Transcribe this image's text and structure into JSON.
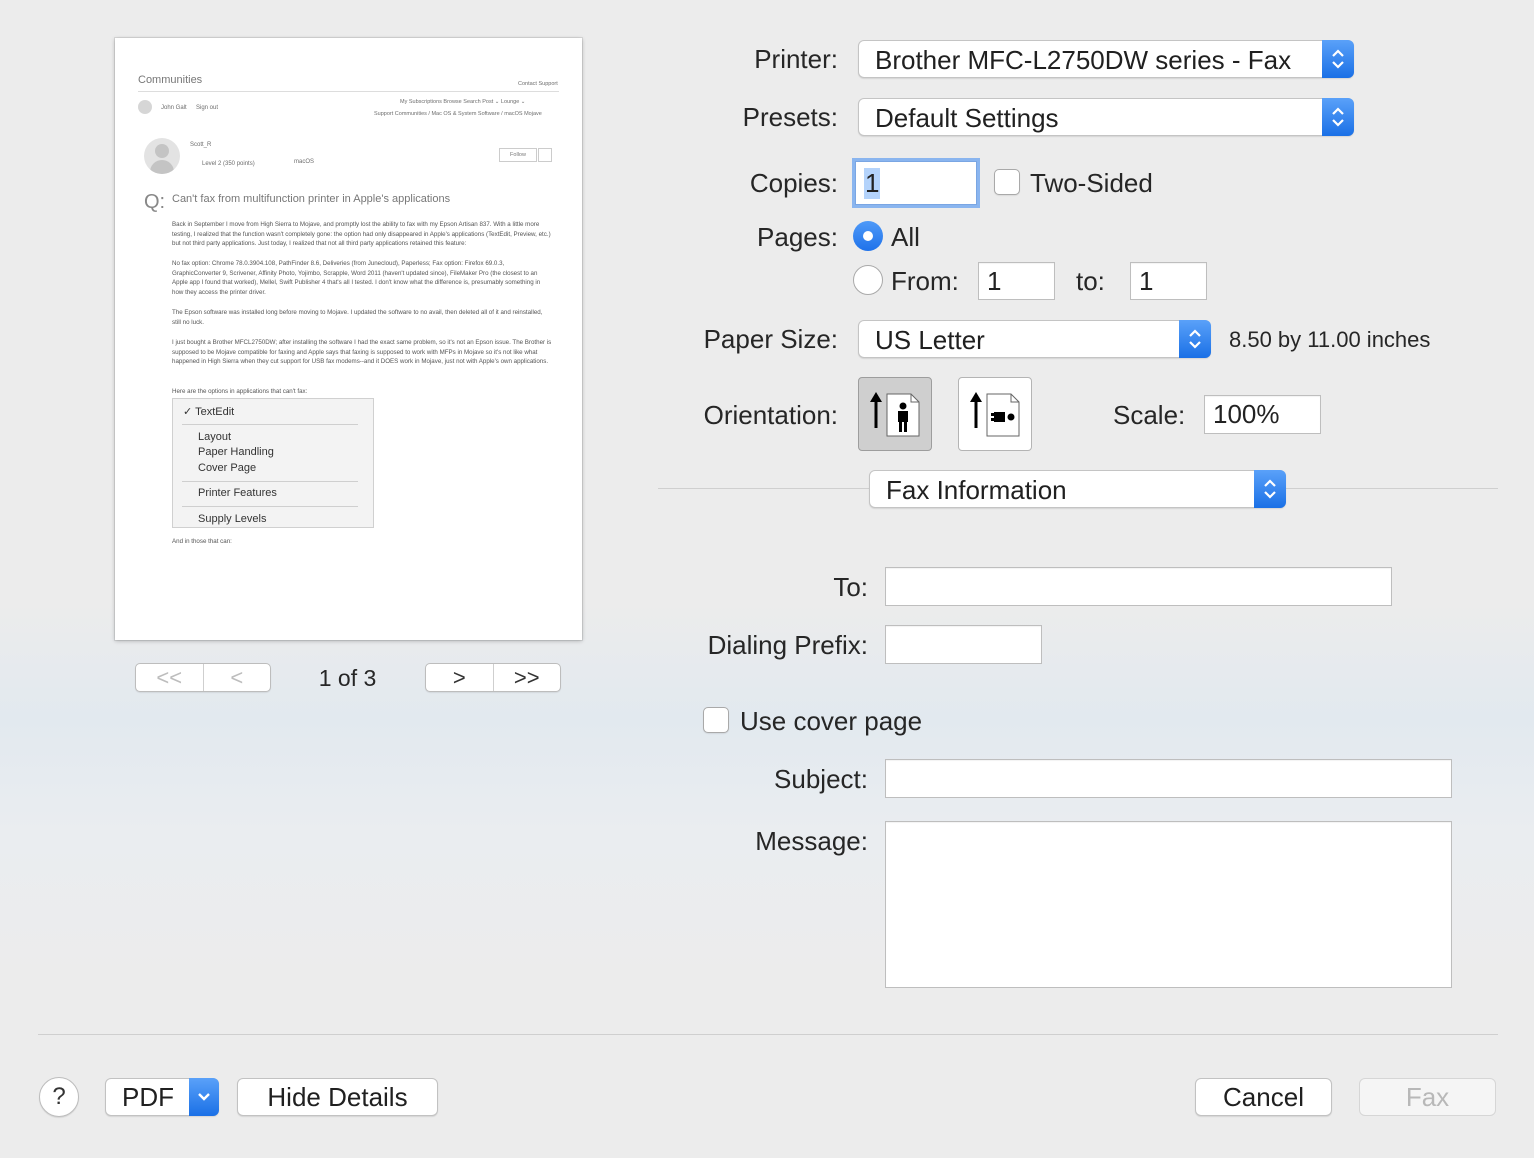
{
  "preview": {
    "header_title": "Communities",
    "contact_support": "Contact Support",
    "user_name": "John Galt",
    "sign_out": "Sign out",
    "nav_links": "My Subscriptions     Browse     Search     Post ⌄     Lounge ⌄",
    "breadcrumb": "Support Communities  /  Mac OS & System Software  /  macOS Mojave",
    "author": "Scott_R",
    "author_level": "Level 2  (350 points)",
    "product": "macOS",
    "follow": "Follow",
    "q_mark": "Q:",
    "question_title": "Can't fax from multifunction printer in Apple's applications",
    "para1": "Back in September I move from High Sierra to Mojave, and promptly lost the ability to fax with my Epson Artisan 837. With a little more testing, I realized that the function wasn't completely gone: the option had only disappeared in Apple's applications (TextEdit, Preview, etc.) but not third party applications. Just today, I realized that not all third party applications retained this feature:",
    "para1b": "No fax option: Chrome 78.0.3904.108, PathFinder 8.6, Deliveries (from Junecloud), Paperless; Fax option: Firefox 69.0.3, GraphicConverter 9, Scrivener, Affinity Photo, Yojimbo, Scrapple, Word 2011 (haven't updated since), FileMaker Pro (the closest to an Apple app I found that worked), Mellel, Swift Publisher 4 that's all I tested. I don't know what the difference is, presumably something in how they access the printer driver.",
    "para2": "The Epson software was installed long before moving to Mojave. I updated the software to no avail, then deleted all of it and reinstalled, still no luck.",
    "para3": "I just bought a Brother MFCL2750DW; after installing the software I had the exact same problem, so it's not an Epson issue. The Brother is supposed to be Mojave compatible for faxing and Apple says that faxing is supposed to work with MFPs in Mojave so it's not like what happened in High Sierra when they cut support for USB fax modems--and it DOES work in Mojave, just not with Apple's own applications.",
    "para4": "Here are the options in applications that can't fax:",
    "menu_items": [
      "✓  TextEdit",
      "Layout",
      "Paper Handling",
      "Cover Page",
      "Printer Features",
      "Supply Levels"
    ],
    "para5": "And in those that can:"
  },
  "page_nav": {
    "first": "<<",
    "prev": "<",
    "status": "1 of 3",
    "next": ">",
    "last": ">>"
  },
  "printer": {
    "label": "Printer:",
    "value": "Brother MFC-L2750DW series - Fax"
  },
  "presets": {
    "label": "Presets:",
    "value": "Default Settings"
  },
  "copies": {
    "label": "Copies:",
    "value": "1",
    "two_sided_label": "Two-Sided",
    "two_sided_checked": false
  },
  "pages": {
    "label": "Pages:",
    "all_label": "All",
    "from_label": "From:",
    "from_value": "1",
    "to_label": "to:",
    "to_value": "1",
    "selected": "All"
  },
  "paper_size": {
    "label": "Paper Size:",
    "value": "US Letter",
    "dimensions": "8.50 by 11.00 inches"
  },
  "orientation": {
    "label": "Orientation:",
    "selected": "portrait"
  },
  "scale": {
    "label": "Scale:",
    "value": "100%"
  },
  "section_popup": {
    "value": "Fax Information"
  },
  "fax": {
    "to_label": "To:",
    "to_value": "",
    "prefix_label": "Dialing Prefix:",
    "prefix_value": "",
    "cover_label": "Use cover page",
    "cover_checked": false,
    "subject_label": "Subject:",
    "subject_value": "",
    "message_label": "Message:",
    "message_value": ""
  },
  "footer": {
    "help": "?",
    "pdf": "PDF",
    "hide_details": "Hide Details",
    "cancel": "Cancel",
    "fax": "Fax"
  },
  "colors": {
    "accent": "#1f72ea",
    "selection": "#b4d3fb"
  }
}
